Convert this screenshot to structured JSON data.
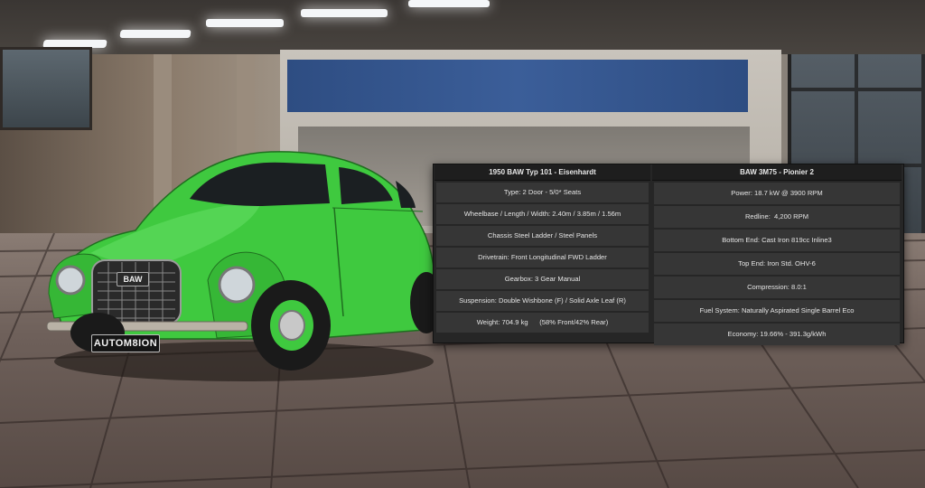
{
  "car": {
    "badge": "BAW",
    "license_plate": "AUTOM8ION",
    "body_color": "#3fc93f"
  },
  "spec_panel": {
    "model": {
      "title": "1950 BAW Typ 101 - Eisenhardt",
      "rows": [
        "Type: 2 Door - 5/0* Seats",
        "Wheelbase / Length / Width: 2.40m / 3.85m / 1.56m",
        "Chassis Steel Ladder / Steel Panels",
        "Drivetrain: Front Longitudinal FWD Ladder",
        "Gearbox: 3 Gear Manual",
        "Suspension: Double Wishbone (F) / Solid Axle Leaf (R)",
        "Weight: 704.9 kg      (58% Front/42% Rear)"
      ]
    },
    "engine": {
      "title": "BAW 3M75 - Pionier 2",
      "rows": [
        "Power: 18.7 kW @ 3900 RPM",
        "Redline:  4,200 RPM",
        "Bottom End: Cast Iron 819cc Inline3",
        "Top End: Iron Std. OHV-6",
        "Compression: 8.0:1",
        "Fuel System: Naturally Aspirated Single Barrel Eco",
        "Economy: 19.66% - 391.3g/kWh"
      ]
    }
  }
}
